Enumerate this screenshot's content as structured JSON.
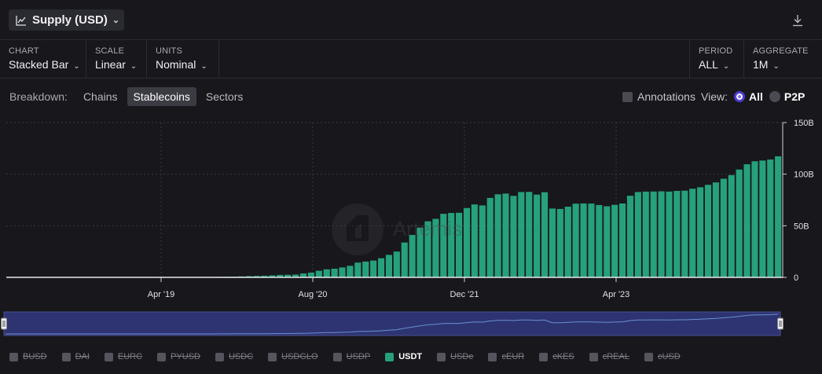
{
  "header": {
    "title": "Supply (USD)",
    "title_icon": "line-chart-icon",
    "download_icon": "download-icon"
  },
  "controls": {
    "chart": {
      "label": "CHART",
      "value": "Stacked Bar"
    },
    "scale": {
      "label": "SCALE",
      "value": "Linear"
    },
    "units": {
      "label": "UNITS",
      "value": "Nominal"
    },
    "period": {
      "label": "PERIOD",
      "value": "ALL"
    },
    "aggregate": {
      "label": "AGGREGATE",
      "value": "1M"
    }
  },
  "breakdown": {
    "label": "Breakdown:",
    "options": [
      "Chains",
      "Stablecoins",
      "Sectors"
    ],
    "active": "Stablecoins"
  },
  "annotations_label": "Annotations",
  "view": {
    "label": "View:",
    "options": [
      "All",
      "P2P"
    ],
    "selected": "All"
  },
  "watermark": "Artemis",
  "legend": [
    {
      "label": "BUSD",
      "active": false
    },
    {
      "label": "DAI",
      "active": false
    },
    {
      "label": "EURC",
      "active": false
    },
    {
      "label": "PYUSD",
      "active": false
    },
    {
      "label": "USDC",
      "active": false
    },
    {
      "label": "USDGLO",
      "active": false
    },
    {
      "label": "USDP",
      "active": false
    },
    {
      "label": "USDT",
      "active": true,
      "color": "#26a17b"
    },
    {
      "label": "USDe",
      "active": false
    },
    {
      "label": "cEUR",
      "active": false
    },
    {
      "label": "cKES",
      "active": false
    },
    {
      "label": "cREAL",
      "active": false
    },
    {
      "label": "cUSD",
      "active": false
    }
  ],
  "chart_data": {
    "type": "bar",
    "stacked": true,
    "title": "Supply (USD)",
    "y_unit": "B",
    "ylim": [
      0,
      150
    ],
    "y_ticks": [
      0,
      50,
      100,
      150
    ],
    "y_axis_position": "right",
    "x_ticks": [
      "Apr '19",
      "Aug '20",
      "Dec '21",
      "Apr '23"
    ],
    "grid": true,
    "series": [
      {
        "name": "USDT",
        "color": "#26a17b",
        "values": [
          0.5,
          0.6,
          0.7,
          0.9,
          1.2,
          1.4,
          1.6,
          1.9,
          2.4,
          2.5,
          2.7,
          3.8,
          4.6,
          6.4,
          7.8,
          8.4,
          9.6,
          11.2,
          14.3,
          15.3,
          16.3,
          18.5,
          21.8,
          25.0,
          33.8,
          41.1,
          48.2,
          54.3,
          56.7,
          61.6,
          62.4,
          62.6,
          67.2,
          70.7,
          69.7,
          77.0,
          80.5,
          81.2,
          79.0,
          82.7,
          82.8,
          80.2,
          82.5,
          66.7,
          66.3,
          68.5,
          71.4,
          71.6,
          71.5,
          70.1,
          68.9,
          70.3,
          71.6,
          79.1,
          82.7,
          83.1,
          83.2,
          83.4,
          83.1,
          83.8,
          84.0,
          85.9,
          87.3,
          89.7,
          92.0,
          95.6,
          99.1,
          104.5,
          109.6,
          112.5,
          113.2,
          114.2,
          117.3
        ]
      }
    ],
    "first_bar_month": "Jun '19",
    "last_bar_month": "Jun '25",
    "legend_position": "bottom"
  }
}
